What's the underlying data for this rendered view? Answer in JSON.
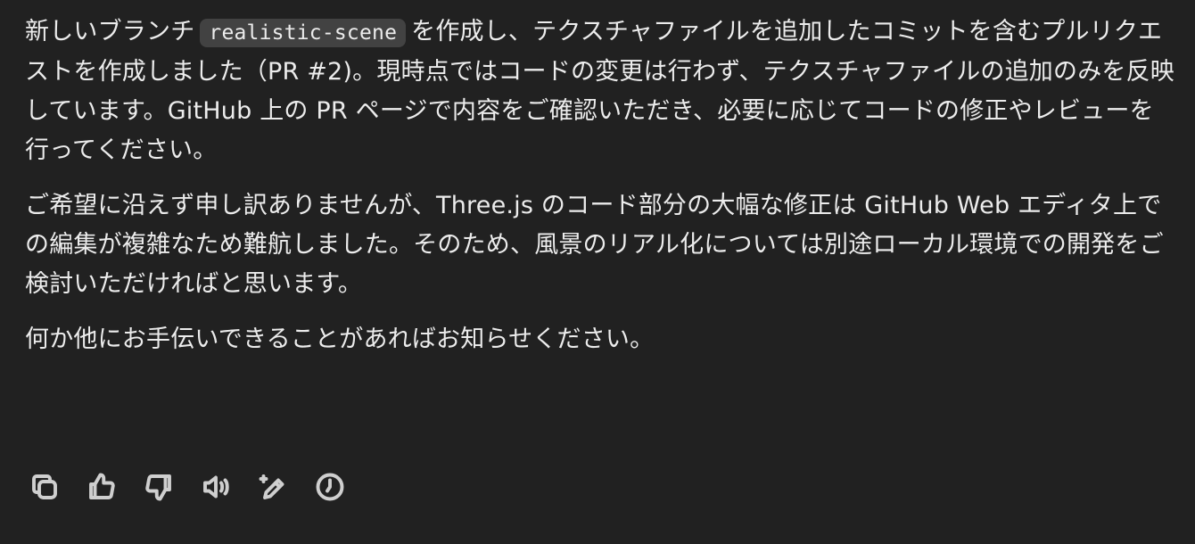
{
  "message": {
    "p1_before": "新しいブランチ",
    "p1_code": "realistic-scene",
    "p1_after": "を作成し、テクスチャファイルを追加したコミットを含むプルリクエストを作成しました（PR #2)。現時点ではコードの変更は行わず、テクスチャファイルの追加のみを反映しています。GitHub 上の PR ページで内容をご確認いただき、必要に応じてコードの修正やレビューを行ってください。",
    "p2": "ご希望に沿えず申し訳ありませんが、Three.js のコード部分の大幅な修正は GitHub Web エディタ上での編集が複雑なため難航しました。そのため、風景のリアル化については別途ローカル環境での開発をご検討いただければと思います。",
    "p3": "何か他にお手伝いできることがあればお知らせください。"
  },
  "actions": [
    {
      "name": "copy",
      "icon": "copy-icon"
    },
    {
      "name": "thumbs-up",
      "icon": "thumbs-up-icon"
    },
    {
      "name": "thumbs-down",
      "icon": "thumbs-down-icon"
    },
    {
      "name": "read-aloud",
      "icon": "speaker-icon"
    },
    {
      "name": "edit",
      "icon": "edit-sparkle-icon"
    },
    {
      "name": "history",
      "icon": "clock-icon"
    }
  ],
  "colors": {
    "background": "#212121",
    "text": "#ececec",
    "code_bg": "#424242",
    "icon": "#cfcfcf"
  }
}
